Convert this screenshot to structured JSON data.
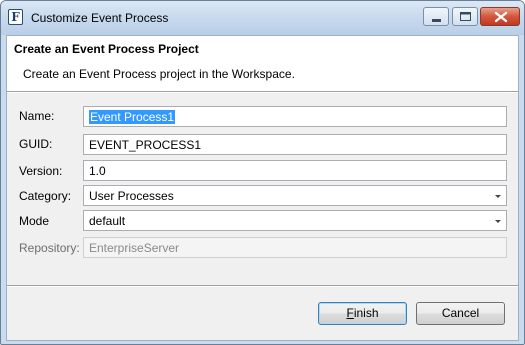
{
  "window": {
    "title": "Customize Event Process"
  },
  "header": {
    "title": "Create an Event Process Project",
    "description": "Create an Event Process project in the Workspace."
  },
  "form": {
    "name": {
      "label": "Name:",
      "value": "Event Process1"
    },
    "guid": {
      "label": "GUID:",
      "value": "EVENT_PROCESS1"
    },
    "version": {
      "label": "Version:",
      "value": "1.0"
    },
    "category": {
      "label": "Category:",
      "value": "User Processes"
    },
    "mode": {
      "label": "Mode",
      "value": "default"
    },
    "repository": {
      "label": "Repository:",
      "value": "EnterpriseServer"
    }
  },
  "buttons": {
    "finish_mnemonic": "F",
    "finish_rest": "inish",
    "cancel": "Cancel"
  },
  "icons": {
    "app": "event-process-app-icon",
    "minimize": "minimize-icon",
    "maximize": "maximize-icon",
    "close": "close-icon",
    "dropdown": "chevron-down-icon"
  }
}
